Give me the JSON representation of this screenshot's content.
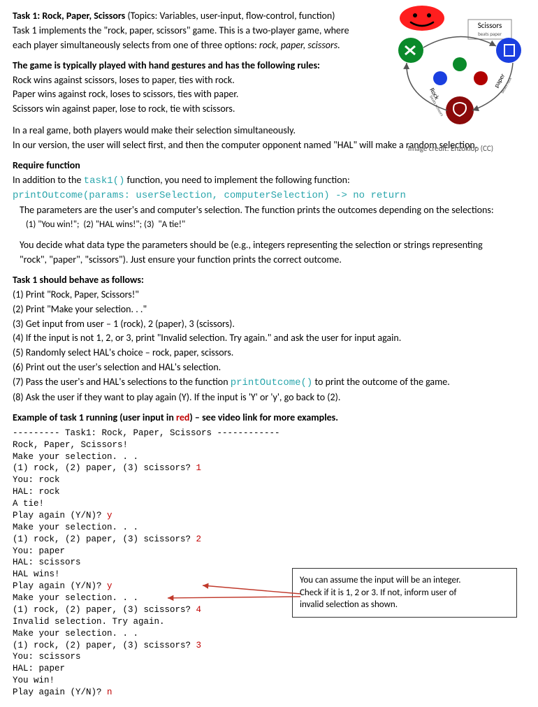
{
  "header": {
    "title_bold": "Task 1: Rock, Paper, Scissors  ",
    "title_topics": "(Topics: Variables, user-input, flow-control, function)",
    "intro1": "Task 1 implements the \"rock, paper, scissors\" game.  This is a two-player game, where",
    "intro2": "each player simultaneously selects from one of three options: ",
    "intro2_em": "rock, paper, scissors."
  },
  "diagram": {
    "scissors": "Scissors",
    "beats_paper": "beats paper",
    "rock": "Rock",
    "beats_scissors": "beats scissors",
    "paper": "paper",
    "beats_rock": "beats rock",
    "caption": "Image credit: Enzoklop (CC)"
  },
  "rules": {
    "head": "The game is typically played with hand gestures and has the following rules:",
    "r1": "Rock wins against scissors, loses to paper, ties with rock.",
    "r2": "Paper wins against rock, loses to scissors, ties with paper.",
    "r3": "Scissors win against paper, lose to rock, tie with scissors."
  },
  "simul": {
    "l1": "In a real game, both players would make their selection simultaneously.",
    "l2": "In our version, the user will select first, and then the computer opponent named \"HAL\" will make a random selection."
  },
  "reqfn": {
    "head": "Require function",
    "l1a": "In addition to the ",
    "l1_code": "task1()",
    "l1b": " function, you need to implement the following function:",
    "sig": "printOutcome(params: userSelection, computerSelection) -> no return",
    "l2": "The parameters are the user's and computer's selection. The function prints the outcomes depending on the selections:",
    "l3": "   (1) \"You win!\";  (2) \"HAL wins!\"; (3)  \"A tie!\"",
    "l4": "You decide what data type the parameters should be (e.g., integers representing the selection or strings representing",
    "l5": "\"rock\", \"paper\", \"scissors\").  Just ensure your function prints the correct outcome."
  },
  "behave": {
    "head": "Task 1 should behave as follows:",
    "s1": "(1) Print \"Rock, Paper, Scissors!\"",
    "s2": "(2) Print \"Make your selection. . .\"",
    "s3": "(3) Get input from user – 1 (rock), 2 (paper), 3 (scissors).",
    "s4": "(4) If the input is not 1, 2, or 3, print \"Invalid selection. Try again.\" and ask the user for input again.",
    "s5": "(5) Randomly select HAL's choice – rock, paper, scissors.",
    "s6": "(6) Print out the user's selection and HAL's selection.",
    "s7a": "(7) Pass the user's and HAL's selections to the function ",
    "s7_code": "printOutcome()",
    "s7b": " to print the outcome of the game.",
    "s8": "(8) Ask the user if they want to play again (Y).  If the input is 'Y' or 'y', go back to (2)."
  },
  "example": {
    "head_a": "Example of task 1 running (user input in ",
    "head_red": "red",
    "head_b": ") – see video link for more examples."
  },
  "run": {
    "l00": "--------- Task1: Rock, Paper, Scissors ------------",
    "l01": "Rock, Paper, Scissors!",
    "l02": "Make your selection. . .",
    "l03": "(1) rock, (2) paper, (3) scissors? ",
    "i03": "1",
    "l04": "You: rock",
    "l05": "HAL: rock",
    "l06": "A tie!",
    "l07": "Play again (Y/N)? ",
    "i07": "y",
    "l08": "Make your selection. . .",
    "l09": "(1) rock, (2) paper, (3) scissors? ",
    "i09": "2",
    "l10": "You: paper",
    "l11": "HAL: scissors",
    "l12": "HAL wins!",
    "l13": "Play again (Y/N)? ",
    "i13": "y",
    "l14": "Make your selection. . .",
    "l15": "(1) rock, (2) paper, (3) scissors? ",
    "i15": "4",
    "l16": "Invalid selection. Try again.",
    "l17": "Make your selection. . .",
    "l18": "(1) rock, (2) paper, (3) scissors? ",
    "i18": "3",
    "l19": "You: scissors",
    "l20": "HAL: paper",
    "l21": "You win!",
    "l22": "Play again (Y/N)? ",
    "i22": "n"
  },
  "callout": {
    "l1": "You can assume the input will be an integer.",
    "l2": "Check if it is 1, 2 or 3.  If not, inform user of",
    "l3": "invalid selection as shown."
  }
}
